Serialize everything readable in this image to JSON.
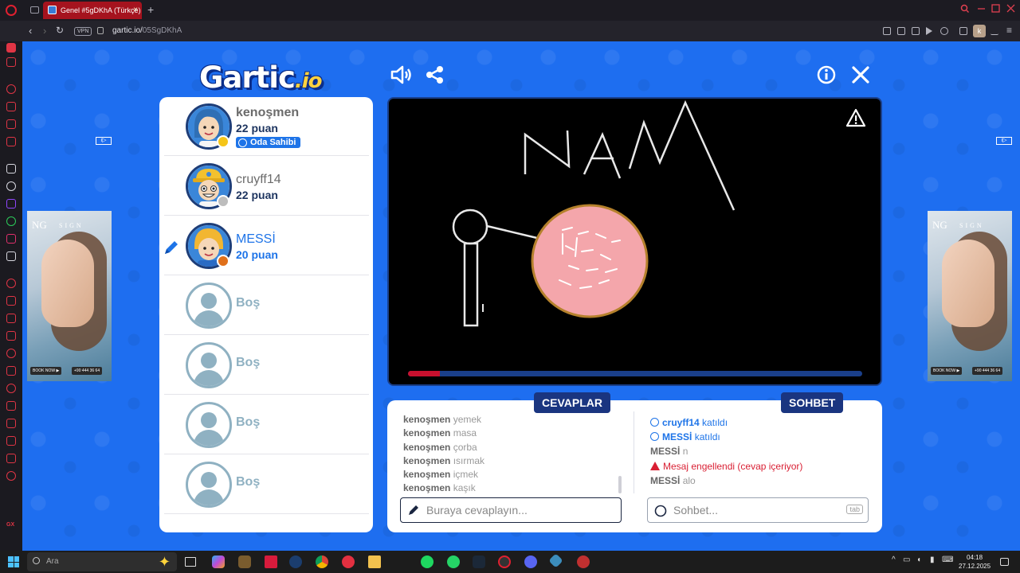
{
  "browser": {
    "tab_title": "Genel #5gDKhA (Türkçe)",
    "tab_close": "×",
    "new_tab": "+",
    "vpn_label": "VPN",
    "url_host": "gartic.io/",
    "url_path": "05SgDKhA",
    "profile_letter": "k"
  },
  "header": {
    "logo_text": "Gartic",
    "logo_suffix": ".io"
  },
  "players": [
    {
      "name": "kenoşmen",
      "score": "22 puan",
      "badge": "Oda Sahibi",
      "status_color": "#f5c518",
      "avatar_bg": "#3a86d9",
      "hair": "#2f6fb5"
    },
    {
      "name": "cruyff14",
      "score": "22 puan",
      "status_color": "#bdbdbd",
      "avatar_bg": "#3a86d9",
      "hair": "#f2c12e"
    },
    {
      "name": "MESSİ",
      "score": "20 puan",
      "status_color": "#e0701a",
      "avatar_bg": "#3a86d9",
      "hair": "#f2b632",
      "drawing": true
    }
  ],
  "empty_slot_label": "Boş",
  "canvas": {
    "progress_percent": 7,
    "accent": "#c8102e"
  },
  "answers": {
    "title": "CEVAPLAR",
    "items": [
      {
        "user": "kenoşmen",
        "text": "yemek"
      },
      {
        "user": "kenoşmen",
        "text": "masa"
      },
      {
        "user": "kenoşmen",
        "text": "çorba"
      },
      {
        "user": "kenoşmen",
        "text": "ısırmak"
      },
      {
        "user": "kenoşmen",
        "text": "içmek"
      },
      {
        "user": "kenoşmen",
        "text": "kaşık"
      }
    ],
    "input_placeholder": "Buraya cevaplayın..."
  },
  "chat": {
    "title": "SOHBET",
    "join1_user": "cruyff14",
    "join1_text": "katıldı",
    "join2_user": "MESSİ",
    "join2_text": "katıldı",
    "msg1_user": "MESSİ",
    "msg1_text": "n",
    "blocked_text": "Mesaj engellendi (cevap içeriyor)",
    "msg2_user": "MESSİ",
    "msg2_text": "alo",
    "input_placeholder": "Sohbet...",
    "tab_hint": "tab"
  },
  "ads": {
    "brand": "NG",
    "brand_sub": "SIGN",
    "book": "BOOK NOW ▶",
    "phone": "+90 444 36 64"
  },
  "taskbar": {
    "search_placeholder": "Ara",
    "time": "04:18",
    "date": "27.12.2025"
  },
  "colors": {
    "page_bg": "#1e6ef0",
    "panel_dark": "#1a3580",
    "blue": "#1e74e8",
    "red": "#d91f33"
  }
}
